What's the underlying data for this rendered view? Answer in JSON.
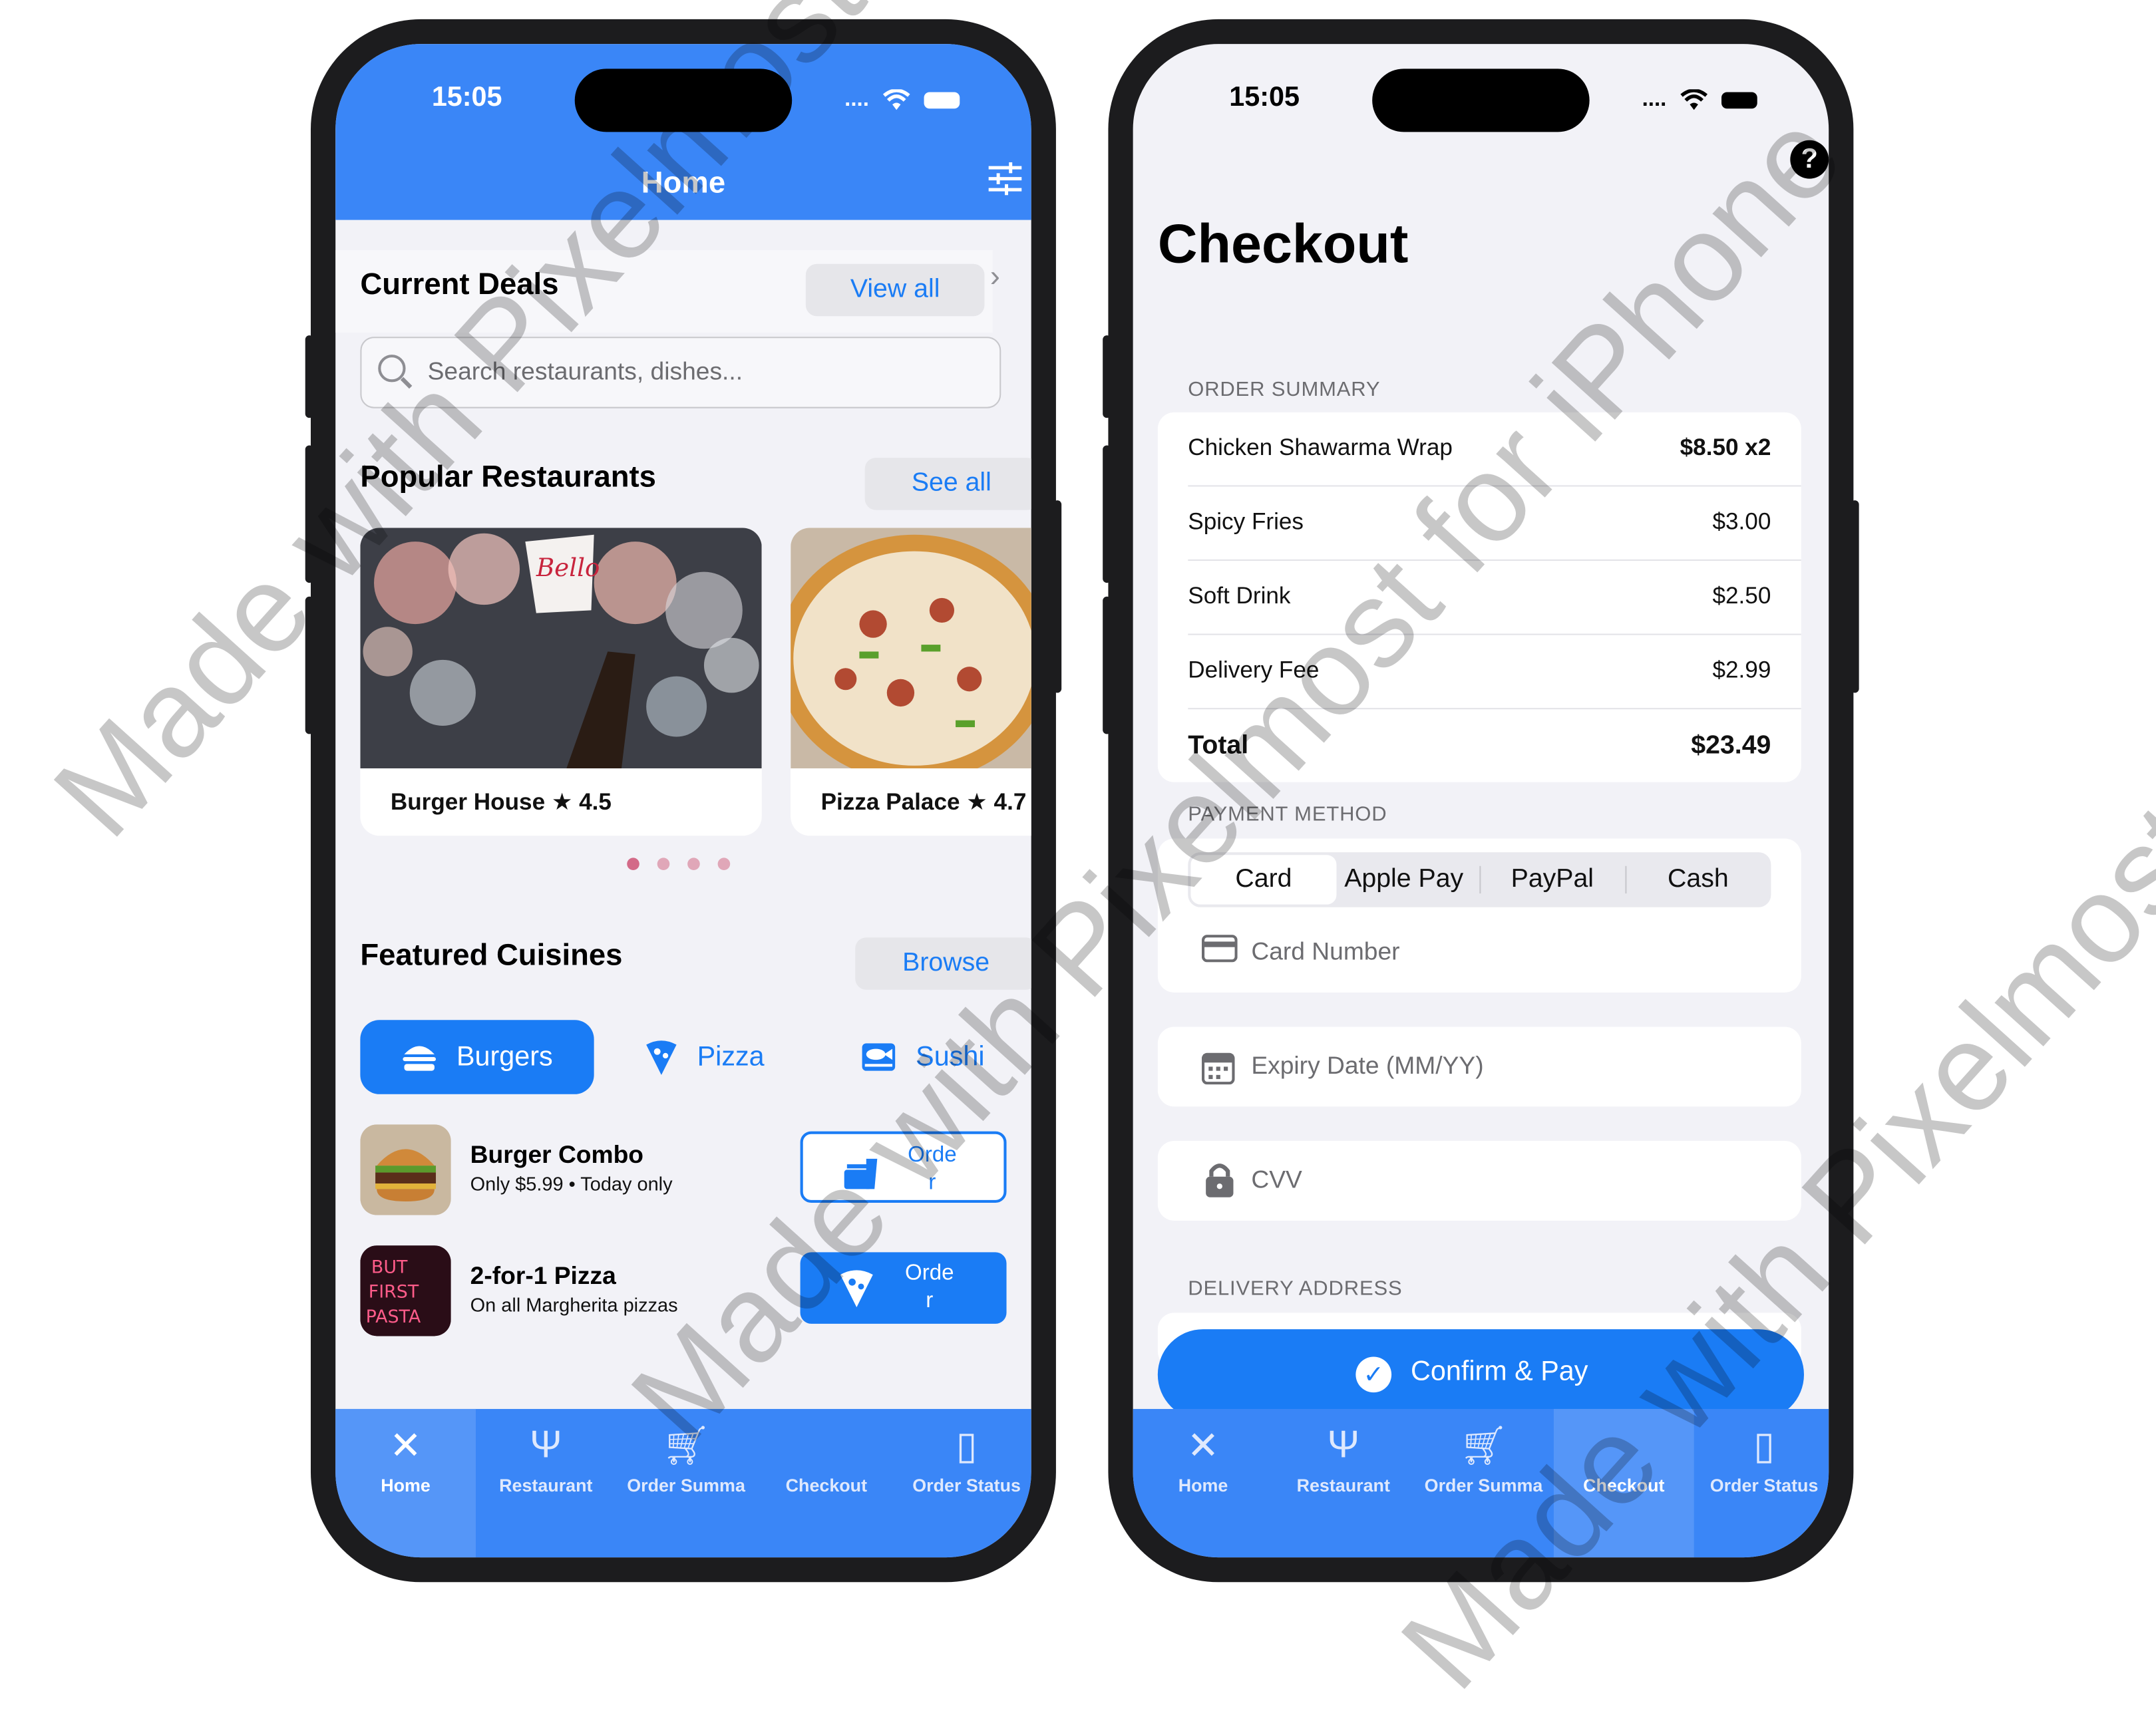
{
  "left_phone": {
    "status": {
      "time": "15:05",
      "signal": "....",
      "wifi": "wifi-icon",
      "battery": "battery-icon"
    },
    "header": {
      "title": "Home",
      "filter_icon": "sliders-icon"
    },
    "deals": {
      "title": "Current Deals",
      "view_all": "View all",
      "chevron": "›"
    },
    "search": {
      "placeholder": "Search restaurants, dishes..."
    },
    "popular": {
      "title": "Popular Restaurants",
      "see_all": "See all",
      "cards": [
        {
          "name": "Burger House ★ 4.5"
        },
        {
          "name": "Pizza Palace ★ 4.7"
        }
      ],
      "page_dots": 4,
      "active_dot": 0
    },
    "featured": {
      "title": "Featured Cuisines",
      "browse": "Browse",
      "chips": [
        {
          "label": "Burgers",
          "icon": "burger-icon",
          "selected": true
        },
        {
          "label": "Pizza",
          "icon": "pizza-icon",
          "selected": false
        },
        {
          "label": "Sushi",
          "icon": "fish-icon",
          "selected": false
        }
      ]
    },
    "deal_items": [
      {
        "title": "Burger Combo",
        "subtitle": "Only $5.99 • Today only",
        "button": "Orde\nr",
        "button_line1": "Orde",
        "button_line2": "r"
      },
      {
        "title": "2-for-1 Pizza",
        "subtitle": "On all Margherita pizzas",
        "button_line1": "Orde",
        "button_line2": "r"
      }
    ],
    "tabbar": [
      {
        "label": "Home",
        "active": true
      },
      {
        "label": "Restaurant",
        "active": false
      },
      {
        "label": "Order Summa",
        "active": false
      },
      {
        "label": "Checkout",
        "active": false
      },
      {
        "label": "Order Status",
        "active": false
      }
    ]
  },
  "right_phone": {
    "status": {
      "time": "15:05",
      "signal": "...."
    },
    "help_icon": "?",
    "title": "Checkout",
    "order_summary": {
      "caption": "ORDER SUMMARY",
      "items": [
        {
          "name": "Chicken Shawarma Wrap",
          "price": "$8.50 x2"
        },
        {
          "name": "Spicy Fries",
          "price": "$3.00"
        },
        {
          "name": "Soft Drink",
          "price": "$2.50"
        },
        {
          "name": "Delivery Fee",
          "price": "$2.99"
        }
      ],
      "total_label": "Total",
      "total_value": "$23.49"
    },
    "payment": {
      "caption": "PAYMENT METHOD",
      "options": [
        "Card",
        "Apple Pay",
        "PayPal",
        "Cash"
      ],
      "selected": "Card",
      "card_number_placeholder": "Card Number",
      "expiry_placeholder": "Expiry Date (MM/YY)",
      "cvv_placeholder": "CVV"
    },
    "delivery": {
      "caption": "DELIVERY ADDRESS"
    },
    "confirm_button": "Confirm & Pay",
    "tabbar": [
      {
        "label": "Home",
        "active": false
      },
      {
        "label": "Restaurant",
        "active": false
      },
      {
        "label": "Order Summa",
        "active": false
      },
      {
        "label": "Checkout",
        "active": true
      },
      {
        "label": "Order Status",
        "active": false
      }
    ]
  },
  "watermark": {
    "text": "Made with Pixelmost for iPhone"
  },
  "colors": {
    "accent": "#1a7cf5",
    "header_blue": "#3a86f7",
    "background": "#f2f2f7"
  }
}
